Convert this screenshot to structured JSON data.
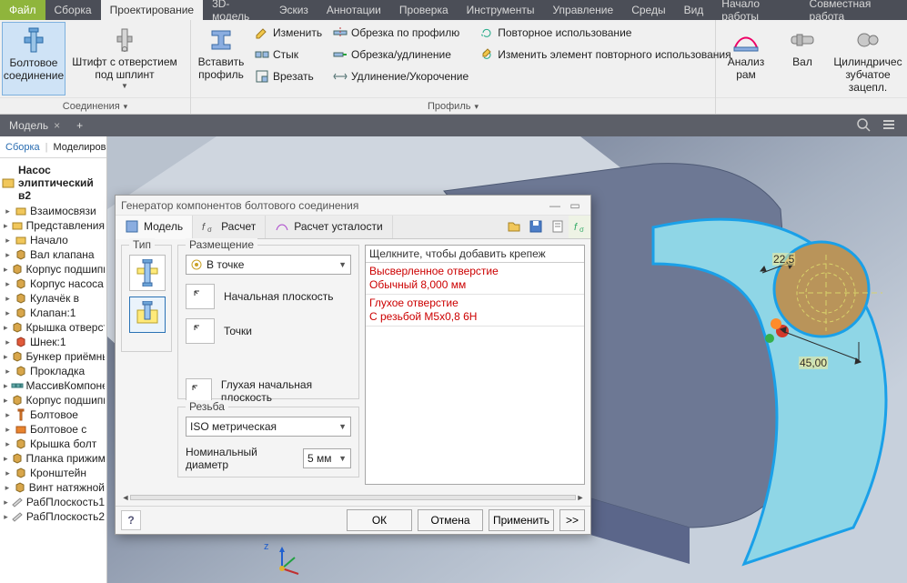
{
  "tabs": {
    "file": "Файл",
    "items": [
      "Сборка",
      "Проектирование",
      "3D-модель",
      "Эскиз",
      "Аннотации",
      "Проверка",
      "Инструменты",
      "Управление",
      "Среды",
      "Вид",
      "Начало работы",
      "Совместная работа"
    ],
    "active_index": 1
  },
  "ribbon": {
    "panel1": {
      "bolt": "Болтовое\nсоединение",
      "pin": "Штифт с отверстием\nпод шплинт",
      "label": "Соединения"
    },
    "panel2": {
      "insert": "Вставить\nпрофиль",
      "edit": "Изменить",
      "butt": "Стык",
      "cut": "Врезать",
      "trimprof": "Обрезка по профилю",
      "trimext": "Обрезка/удлинение",
      "extshort": "Удлинение/Укорочение",
      "reuse": "Повторное использование",
      "editreuse": "Изменить элемент повторного использования",
      "label": "Профиль"
    },
    "panel3": {
      "frame": "Анализ\nрам",
      "shaft": "Вал",
      "gear": "Цилиндричес\nзубчатое зацепл."
    }
  },
  "doc": {
    "name": "Модель"
  },
  "browser": {
    "tabs": {
      "asm": "Сборка",
      "model": "Моделирование"
    },
    "root": "Насос элиптический в2",
    "items": [
      "Взаимосвязи",
      "Представления",
      "Начало",
      "Вал клапана",
      "Корпус подшипника",
      "Корпус насоса",
      "Кулачёк в",
      "Клапан:1",
      "Крышка отверстия",
      "Шнек:1",
      "Бункер приёмный",
      "Прокладка",
      "МассивКомпонент",
      "Корпус подшипника",
      "Болтовое",
      "Болтовое с",
      "Крышка болт",
      "Планка прижимная",
      "Кронштейн",
      "Винт натяжной",
      "РабПлоскость1",
      "РабПлоскость2"
    ],
    "icons": [
      "rel",
      "view",
      "org",
      "part",
      "part",
      "part",
      "part",
      "part",
      "part",
      "red",
      "part",
      "part",
      "arr",
      "part",
      "bolt",
      "asm",
      "part",
      "part",
      "part",
      "part",
      "plane",
      "plane"
    ]
  },
  "dialog": {
    "title": "Генератор компонентов болтового соединения",
    "tabs": {
      "model": "Модель",
      "calc": "Расчет",
      "fatigue": "Расчет усталости"
    },
    "type_label": "Тип",
    "placement": {
      "label": "Размещение",
      "mode": "В точке",
      "start_plane": "Начальная плоскость",
      "points": "Точки",
      "blind_plane": "Глухая начальная плоскость"
    },
    "thread": {
      "label": "Резьба",
      "standard": "ISO метрическая",
      "nominal_label": "Номинальный диаметр",
      "nominal_value": "5 мм"
    },
    "parts": {
      "hint": "Щелкните, чтобы добавить крепеж",
      "h1a": "Высверленное отверстие",
      "h1b": "Обычный 8,000 мм",
      "h2a": "Глухое отверстие",
      "h2b": "С резьбой M5x0,8 6H"
    },
    "buttons": {
      "ok": "ОК",
      "cancel": "Отмена",
      "apply": "Применить",
      "more": ">>"
    }
  },
  "dims": {
    "a": "22,5",
    "b": "45,00"
  },
  "axis": {
    "z": "z"
  }
}
